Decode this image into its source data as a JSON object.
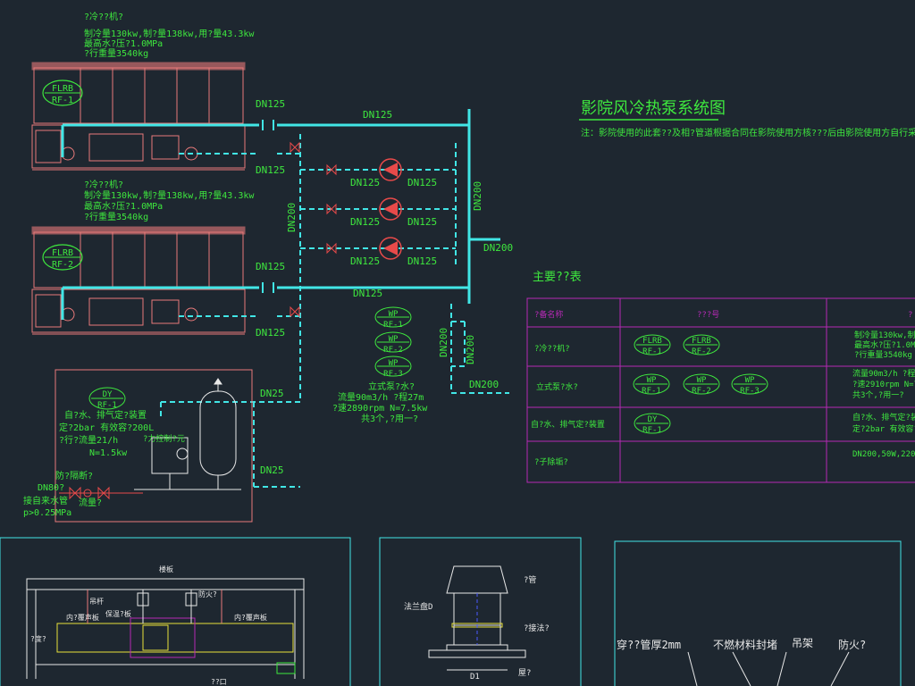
{
  "title": "影院风冷热泵系统图",
  "note": "注：影院使用的此套??及相?管道根据合同在影院使用方核???后由影院使用方自行采?安装",
  "units": {
    "unit1": {
      "code": "FLRB RF-1",
      "spec_lines": [
        "?冷??机?",
        "制冷量130kw,制?量138kw,用?量43.3kw",
        "最高水?压?1.0MPa",
        "?行重量3540kg"
      ]
    },
    "unit2": {
      "code": "FLRB RF-2",
      "spec_lines": [
        "?冷??机?",
        "制冷量130kw,制?量138kw,用?量43.3kw",
        "最高水?压?1.0MPa",
        "?行重量3540kg"
      ]
    }
  },
  "pipe_labels": {
    "dn125_a": "DN125",
    "dn125_b": "DN125",
    "dn125_c": "DN125",
    "dn125_d": "DN125",
    "dn125_e": "DN125",
    "dn125_f": "DN125",
    "dn125_p1l": "DN125",
    "dn125_p1r": "DN125",
    "dn125_p2l": "DN125",
    "dn125_p2r": "DN125",
    "dn125_p3l": "DN125",
    "dn125_p3r": "DN125",
    "dn200_v1": "DN200",
    "dn200_main": "DN200",
    "dn200_right": "DN200",
    "dn200_v2": "DN200",
    "dn200_v3": "DN200",
    "dn200_low": "DN200",
    "dn25_a": "DN25",
    "dn25_b": "DN25",
    "dn80": "DN80?"
  },
  "pumps": {
    "tag1": "WP RF-1",
    "tag2": "WP RF-2",
    "tag3": "WP RF-3",
    "spec_lines": [
      "立式泵?水?",
      "流量90m3/h ?程27m",
      "?速2890rpm N=7.5kw",
      "共3个,?用一?"
    ]
  },
  "makeup": {
    "tag": "DY RF-1",
    "spec_lines": [
      "自?水、排气定?装置",
      "定?2bar 有效容?200L",
      "?行?流量21/h",
      "N=1.5kw"
    ],
    "left_lines": [
      "防?隔断?",
      "接自来水管",
      "p>0.25MPa"
    ],
    "flowmeter": "流量?",
    "pressure_ctl": "?力控制?元"
  },
  "equip_table": {
    "heading": "主要??表",
    "col_name": "?备名称",
    "col_model": "???号",
    "rows": [
      {
        "name": "?冷??机?",
        "tags": [
          "FLRB RF-1",
          "FLRB RF-2"
        ],
        "spec": [
          "制冷量130kw,制?量138kw",
          "最高水?压?1.0MPa",
          "?行重量3540kg"
        ]
      },
      {
        "name": "立式泵?水?",
        "tags": [
          "WP RF-1",
          "WP RF-2",
          "WP RF-3"
        ],
        "spec": [
          "流量90m3/h  ?程27m",
          "?速2910rpm N=7.5kw",
          "共3个,?用一?"
        ]
      },
      {
        "name": "自?水、排气定?装置",
        "tags": [
          "DY RF-1"
        ],
        "spec": [
          "自?水、排气定?装置",
          "定?2bar 有效容?200L"
        ]
      },
      {
        "name": "?子除垢?",
        "tags": [],
        "spec": [
          "DN200,50W,220V"
        ]
      }
    ]
  },
  "detail1": {
    "labels": [
      "楼板",
      "吊杆",
      "防火?",
      "内?覆声板",
      "保温?板",
      "内?覆声板",
      "?度?",
      "??口"
    ]
  },
  "detail2": {
    "labels": [
      "?管",
      "法兰盘D",
      "?接法?",
      "D1",
      "屋?"
    ]
  },
  "detail3": {
    "labels": [
      "穿??管厚2mm",
      "不燃材料封堵",
      "吊架",
      "防火?"
    ]
  },
  "colors": {
    "background": "#1e2730",
    "pipe": "#41e6e6",
    "equipment": "#e87a7a",
    "text": "#3ee83e",
    "table_border": "#b52ab5",
    "pump": "#e84a4a"
  }
}
